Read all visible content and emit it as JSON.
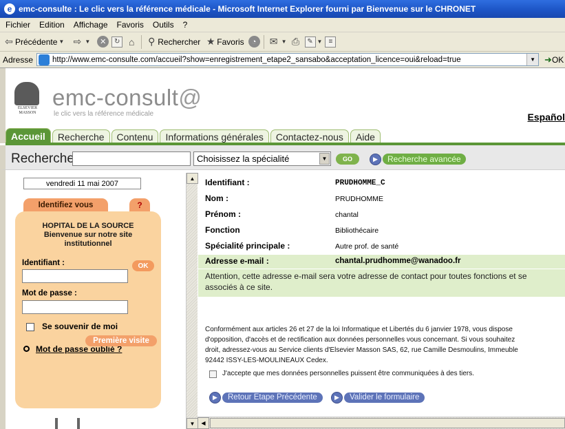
{
  "window": {
    "title": "emc-consulte : Le clic vers la référence médicale - Microsoft Internet Explorer fourni par Bienvenue sur le CHRONET"
  },
  "menu": [
    "Fichier",
    "Edition",
    "Affichage",
    "Favoris",
    "Outils",
    "?"
  ],
  "toolbar": {
    "back_label": "Précédente",
    "search_label": "Rechercher",
    "favorites_label": "Favoris"
  },
  "address": {
    "label": "Adresse",
    "url": "http://www.emc-consulte.com/accueil?show=enregistrement_etape2_sansabo&acceptation_licence=oui&reload=true",
    "go_label": "OK"
  },
  "site": {
    "brand": "emc-consult",
    "brand_at": "@",
    "tagline": "le clic vers la référence médicale",
    "publisher_lines": [
      "ELSEVIER",
      "MASSON"
    ],
    "language_link": "Español"
  },
  "nav_tabs": [
    "Accueil",
    "Recherche",
    "Contenu",
    "Informations générales",
    "Contactez-nous",
    "Aide"
  ],
  "search": {
    "label": "Recherche",
    "input_value": "",
    "specialty_selected": "Choisissez la spécialité",
    "go_label": "GO",
    "advanced_label": "Recherche avancée"
  },
  "sidebar": {
    "date": "vendredi 11 mai 2007",
    "identify_tab": "Identifiez vous",
    "help_tab": "?",
    "institution_lines": [
      "HOPITAL DE LA SOURCE",
      "Bienvenue sur notre site",
      "institutionnel"
    ],
    "identifier_label": "Identifiant :",
    "password_label": "Mot de passe :",
    "ok_label": "OK",
    "remember_label": "Se souvenir de moi",
    "forgot_label": "Mot de passe oublié ?",
    "first_visit_label": "Première visite"
  },
  "profile": {
    "rows": [
      {
        "label": "Identifiant :",
        "value": "PRUDHOMME_C"
      },
      {
        "label": "Nom :",
        "value": "PRUDHOMME"
      },
      {
        "label": "Prénom :",
        "value": "chantal"
      },
      {
        "label": "Fonction",
        "value": "Bibliothécaire"
      },
      {
        "label": "Spécialité principale :",
        "value": "Autre prof. de santé"
      },
      {
        "label": "Adresse e-mail :",
        "value": "chantal.prudhomme@wanadoo.fr"
      }
    ],
    "attention_lines": [
      "Attention, cette adresse e-mail sera votre adresse de contact pour toutes fonctions et se",
      "associés à ce site."
    ],
    "legal_lines": [
      "Conformément aux articles 26 et 27 de la loi Informatique et Libertés du 6 janvier 1978, vous dispose",
      "d'opposition, d'accès et de rectification aux données personnelles vous concernant. Si vous souhaitez",
      "droit, adressez-vous au Service clients d'Elsevier Masson SAS, 62, rue Camille Desmoulins, Immeuble",
      "92442 ISSY-LES-MOULINEAUX Cedex."
    ],
    "consent_label": "J'accepte que mes données personnelles puissent être communiquées à des tiers.",
    "back_button": "Retour Etape Précédente",
    "submit_button": "Valider le formulaire"
  }
}
